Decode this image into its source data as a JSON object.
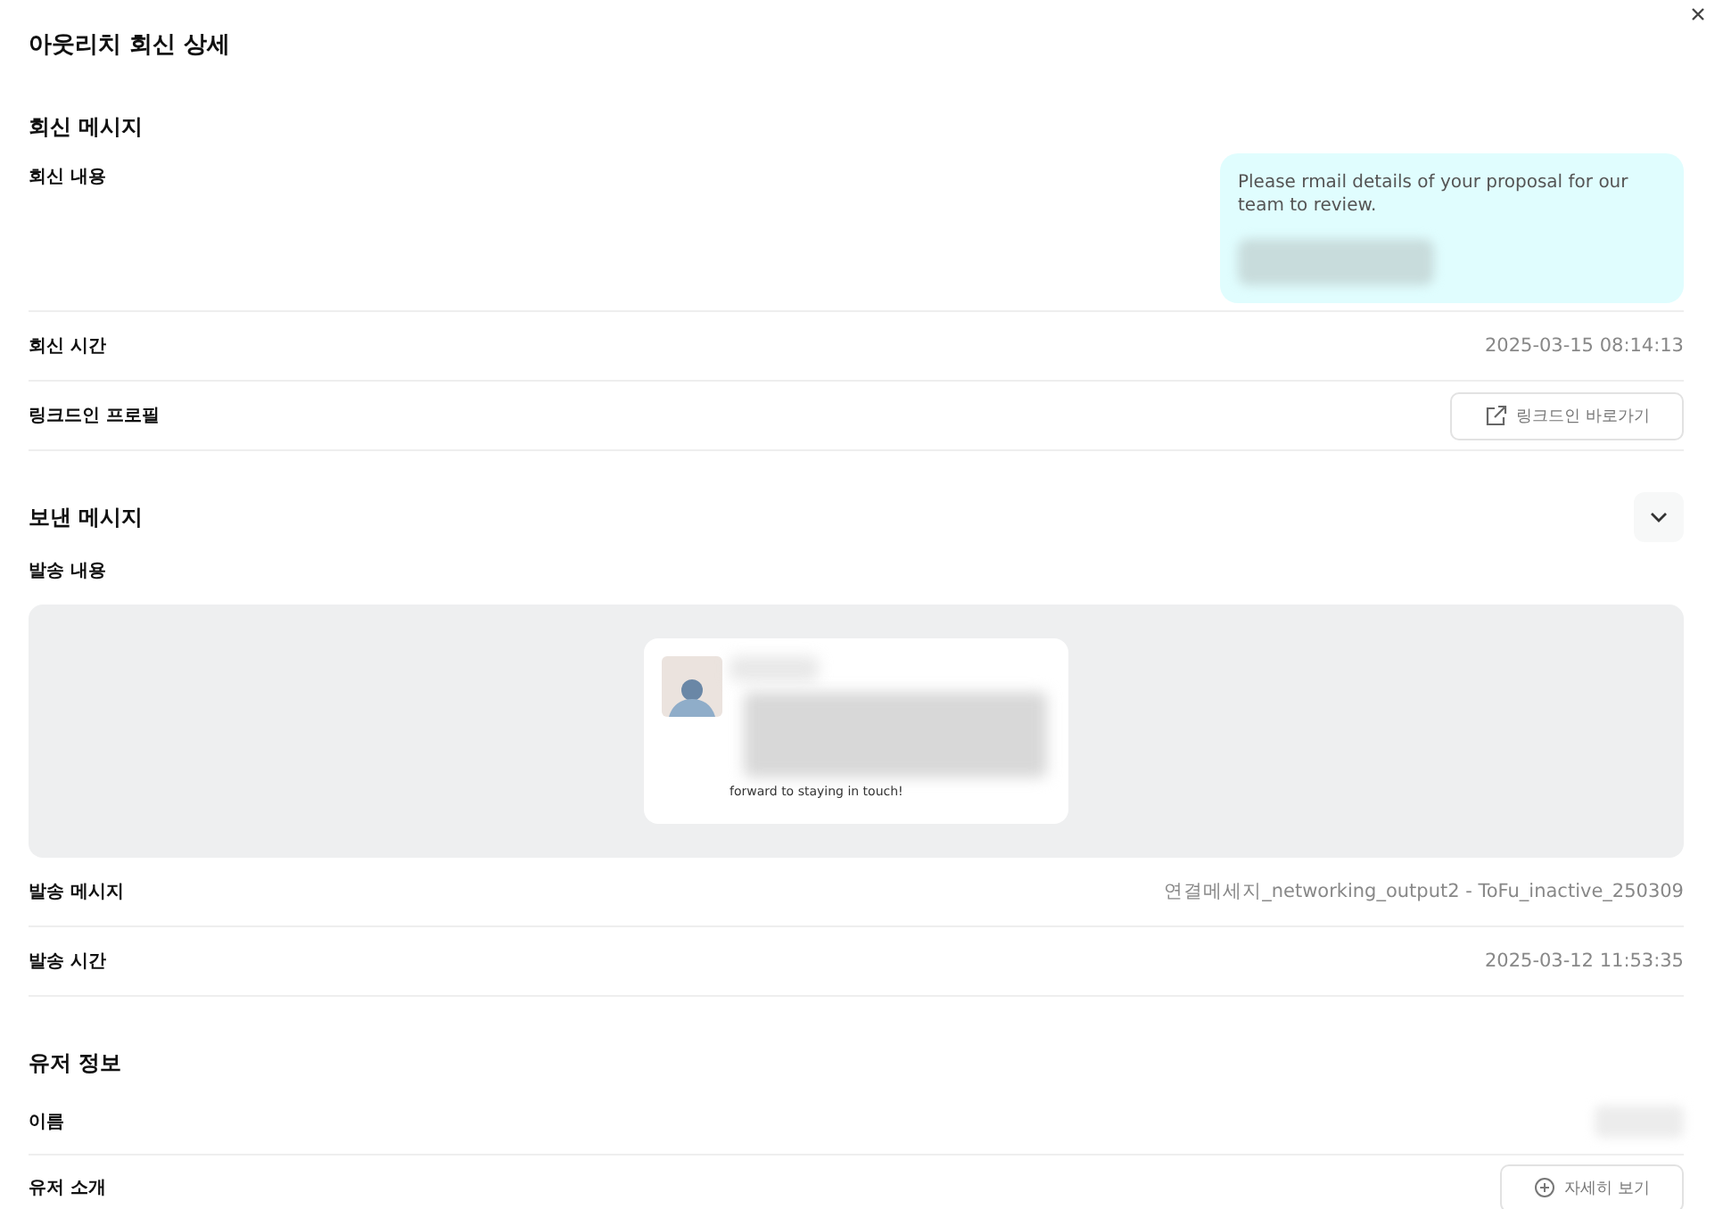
{
  "window": {
    "title": "아웃리치 회신 상세"
  },
  "reply_section": {
    "title": "회신 메시지",
    "rows": [
      {
        "kind": "bubble",
        "label": "회신 내용",
        "value": "Please rmail details of your proposal for our team to review."
      },
      {
        "kind": "text",
        "label": "회신 시간",
        "value": "2025-03-15 08:14:13"
      },
      {
        "kind": "button",
        "label": "링크드인 프로필",
        "value": "링크드인 바로가기"
      }
    ]
  },
  "sent_section": {
    "title": "보낸 메시지",
    "expanded": true,
    "content_label": "발송 내용",
    "preview_text": "forward to staying in touch!",
    "rows": [
      {
        "kind": "text",
        "label": "발송 메시지",
        "value": "연결메세지_networking_output2 - ToFu_inactive_250309"
      },
      {
        "kind": "text",
        "label": "발송 시간",
        "value": "2025-03-12 11:53:35"
      }
    ]
  },
  "user_section": {
    "title": "유저 정보",
    "rows": [
      {
        "kind": "redacted",
        "label": "이름"
      },
      {
        "kind": "button",
        "label": "유저 소개",
        "value": "자세히 보기"
      }
    ]
  }
}
